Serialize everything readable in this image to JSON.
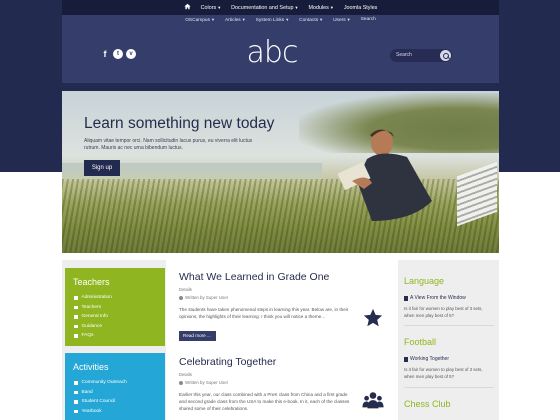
{
  "topnav": {
    "home": "home-icon",
    "items": [
      "Colors",
      "Documentation and Setup",
      "Modules",
      "Joomla Styles"
    ]
  },
  "subnav": {
    "items": [
      "OSCampus",
      "Articles",
      "System Links",
      "Contacts",
      "Users",
      "Search"
    ]
  },
  "header": {
    "logo": "abc",
    "social": [
      "facebook-icon",
      "twitter-icon",
      "vimeo-icon"
    ],
    "social_glyphs": [
      "f",
      "t",
      "v"
    ],
    "search_placeholder": "Search"
  },
  "hero": {
    "title": "Learn something new today",
    "description": "Aliquam vitae tempor orci. Nam sollicitudin lacus purus, eu viverra elit luctus rutrum. Mauris ac nec urna bibendum luctus.",
    "button": "Sign up"
  },
  "sidebar": {
    "teachers": {
      "title": "Teachers",
      "items": [
        "Administration",
        "Teachers",
        "General Info",
        "Guidance",
        "FAQs"
      ]
    },
    "activities": {
      "title": "Activities",
      "items": [
        "Community Outreach",
        "Band",
        "Student Council",
        "Yearbook"
      ]
    }
  },
  "articles": [
    {
      "title": "What We Learned in Grade One",
      "category": "Details",
      "author": "Written by Super User",
      "body": "The students have taken phenomenal steps in learning this year. Below are, in their opinions, the highlights of their learning. I think you will notice a theme...",
      "read_more": "Read more ..."
    },
    {
      "title": "Celebrating Together",
      "category": "Details",
      "author": "Written by Super User",
      "body": "Earlier this year, our class combined with a PreK class from China and a first grade and second grade class from the USA to make this e-book. In it, each of the classes shared some of their celebrations."
    }
  ],
  "right": {
    "sections": [
      {
        "title": "Language",
        "link": "A View From the Window",
        "text": "Is it fair for women to play best of 3 sets, when men play best of 5?"
      },
      {
        "title": "Football",
        "link": "Working Together",
        "text": "Is it fair for women to play best of 3 sets, when men play best of 5?"
      },
      {
        "title": "Chess Club"
      }
    ]
  },
  "colors": {
    "navy": "#232a4f",
    "header": "#353d6b",
    "green": "#8fb620",
    "blue": "#24a7d6"
  }
}
